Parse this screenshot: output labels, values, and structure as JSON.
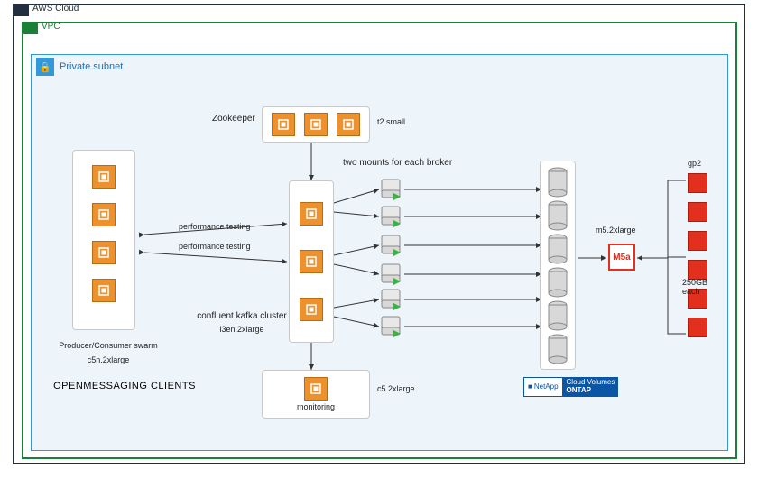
{
  "cloud": {
    "label": "AWS Cloud"
  },
  "vpc": {
    "label": "VPC"
  },
  "subnet": {
    "label": "Private subnet",
    "lock": "🔒"
  },
  "swarm": {
    "title": "Producer/Consumer swarm",
    "instance": "c5n.2xlarge",
    "clients": "OPENMESSAGING CLIENTS",
    "perf1": "performance testing",
    "perf2": "performance testing"
  },
  "zookeeper": {
    "label": "Zookeeper",
    "instance": "t2.small"
  },
  "kafka": {
    "label": "confluent kafka cluster",
    "instance": "i3en.2xlarge",
    "mounts": "two mounts for each broker"
  },
  "monitoring": {
    "label": "monitoring",
    "instance": "c5.2xlarge"
  },
  "ontap": {
    "net": "NetApp",
    "line1": "Cloud Volumes",
    "line2": "ONTAP"
  },
  "ec2fsx": {
    "instance": "m5.2xlarge",
    "badge": "M5a"
  },
  "ebs": {
    "type": "gp2",
    "size": "250GB each"
  },
  "chart_data": {
    "type": "architecture-diagram",
    "nodes": [
      {
        "id": "swarm",
        "label": "Producer/Consumer swarm",
        "instance": "c5n.2xlarge",
        "count": 4,
        "role": "OPENMESSAGING CLIENTS"
      },
      {
        "id": "zookeeper",
        "label": "Zookeeper",
        "instance": "t2.small",
        "count": 3
      },
      {
        "id": "kafka",
        "label": "confluent kafka cluster",
        "instance": "i3en.2xlarge",
        "count": 3
      },
      {
        "id": "monitoring",
        "label": "monitoring",
        "instance": "c5.2xlarge",
        "count": 1
      },
      {
        "id": "broker-mounts",
        "label": "two mounts for each broker",
        "count": 6
      },
      {
        "id": "cvo-vols",
        "label": "Cloud Volumes ONTAP volumes",
        "count": 6
      },
      {
        "id": "cvo-instance",
        "label": "M5a",
        "instance": "m5.2xlarge",
        "count": 1
      },
      {
        "id": "ebs",
        "label": "gp2 250GB each",
        "count": 6
      }
    ],
    "edges": [
      {
        "from": "swarm",
        "to": "kafka",
        "label": "performance testing",
        "bidir": true
      },
      {
        "from": "swarm",
        "to": "kafka",
        "label": "performance testing",
        "bidir": true
      },
      {
        "from": "zookeeper",
        "to": "kafka",
        "bidir": true
      },
      {
        "from": "monitoring",
        "to": "kafka",
        "bidir": true
      },
      {
        "from": "kafka",
        "to": "broker-mounts",
        "label": "two mounts for each broker",
        "fanout": "1->2 x3"
      },
      {
        "from": "broker-mounts",
        "to": "cvo-vols",
        "fanout": "1->1 x6"
      },
      {
        "from": "cvo-vols",
        "to": "cvo-instance"
      },
      {
        "from": "ebs",
        "to": "cvo-instance"
      }
    ]
  }
}
